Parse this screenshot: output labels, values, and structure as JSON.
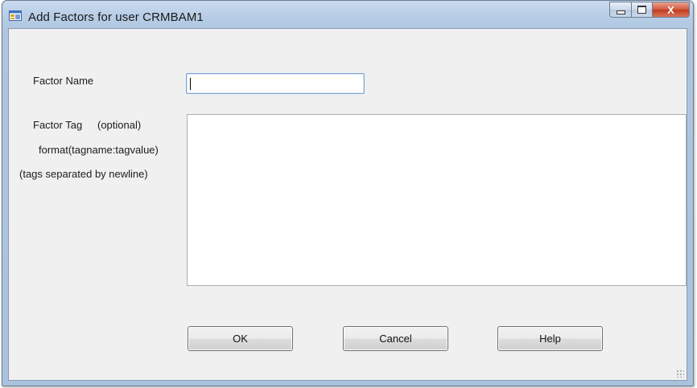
{
  "window": {
    "title": "Add Factors for user CRMBAM1",
    "min_glyph": "",
    "close_glyph": "X"
  },
  "form": {
    "factor_name_label": "Factor Name",
    "factor_name_value": "",
    "factor_tag_label": "Factor Tag",
    "optional_label": "(optional)",
    "format_hint": "format(tagname:tagvalue)",
    "separator_hint": "(tags separated by newline)",
    "factor_tag_value": ""
  },
  "buttons": {
    "ok": "OK",
    "cancel": "Cancel",
    "help": "Help"
  },
  "icons": {
    "app": "form-window-icon",
    "minimize": "minimize-icon",
    "maximize": "maximize-icon",
    "close": "close-icon"
  }
}
